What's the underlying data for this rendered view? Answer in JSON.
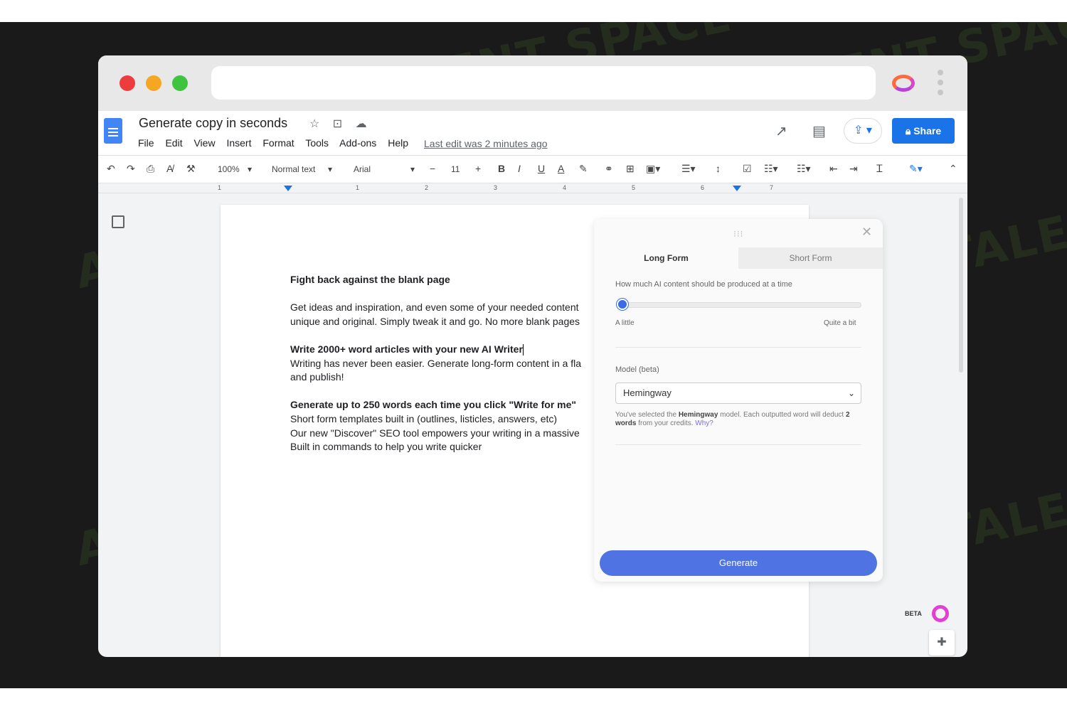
{
  "watermark": "AI TALENT SPACE",
  "doc": {
    "title": "Generate copy in seconds",
    "menus": [
      "File",
      "Edit",
      "View",
      "Insert",
      "Format",
      "Tools",
      "Add-ons",
      "Help"
    ],
    "last_edit": "Last edit was 2 minutes ago",
    "share_label": "Share"
  },
  "toolbar": {
    "zoom": "100%",
    "style": "Normal text",
    "font": "Arial",
    "font_size": "11"
  },
  "ruler": [
    "1",
    "1",
    "2",
    "3",
    "4",
    "5",
    "6",
    "7"
  ],
  "body": {
    "h1": "Fight back against the blank page",
    "p1a": "Get ideas and inspiration, and even some of your needed content",
    "p1b": "unique and original. Simply tweak it and go. No more blank pages",
    "h2": "Write 2000+ word articles with your new AI Writer",
    "p2a": "Writing has never been easier. Generate long-form content in a fla",
    "p2b": "and publish!",
    "h3": "Generate up to 250 words each time you click \"Write for me\"",
    "l1": "Short form templates built in (outlines, listicles, answers, etc)",
    "l2": "Our new \"Discover\" SEO tool empowers your writing in a massive",
    "l3": "Built in commands to help you write quicker"
  },
  "panel": {
    "tab_long": "Long Form",
    "tab_short": "Short Form",
    "slider_label": "How much AI content should be produced at a time",
    "slider_min": "A little",
    "slider_max": "Quite a bit",
    "slider_value": 0,
    "model_label": "Model (beta)",
    "model_value": "Hemingway",
    "note_1": "You've selected the ",
    "note_model": "Hemingway",
    "note_2": " model. Each outputted word will deduct ",
    "note_words": "2 words",
    "note_3": " from your credits. ",
    "note_why": "Why?",
    "generate": "Generate"
  },
  "beta": "BETA",
  "colors": {
    "accent": "#1a73e8",
    "panel_button": "#4f73e3",
    "traffic_red": "#ee3b3b",
    "traffic_yellow": "#f5a623",
    "traffic_green": "#3fc43f"
  }
}
